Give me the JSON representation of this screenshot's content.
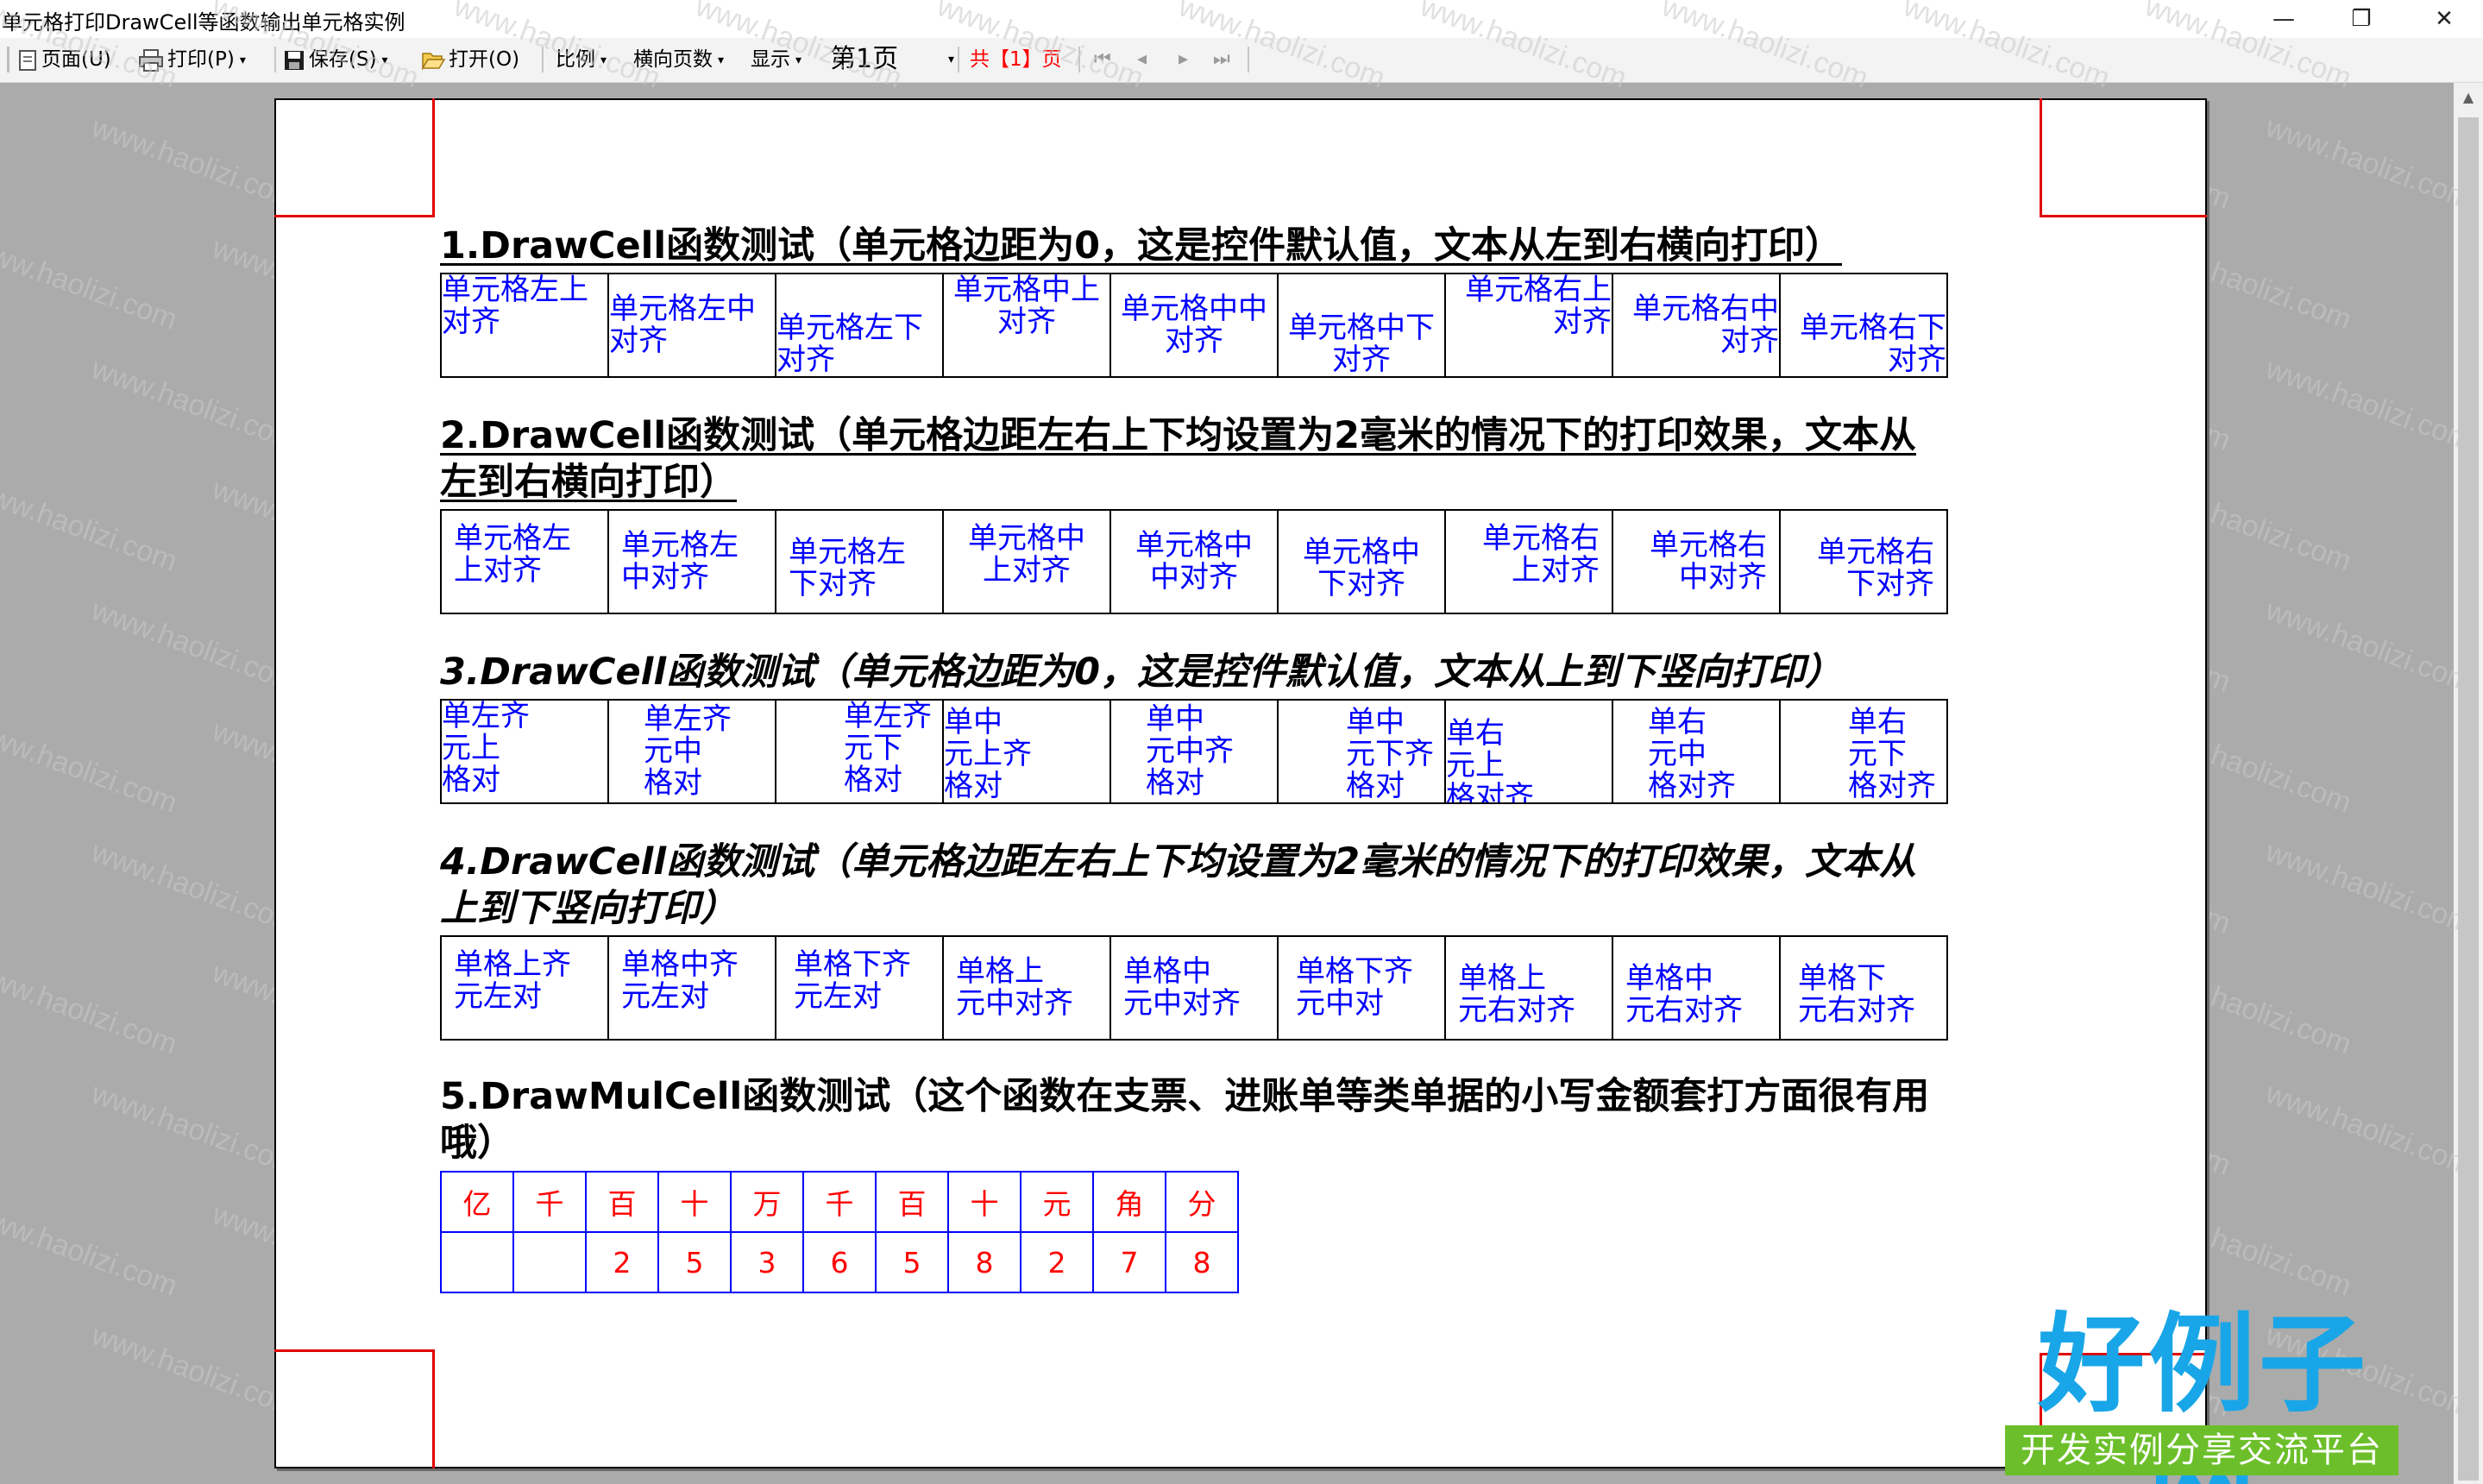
{
  "window": {
    "title": "单元格打印DrawCell等函数输出单元格实例",
    "minimize_glyph": "—",
    "restore_glyph": "❐",
    "close_glyph": "✕"
  },
  "toolbar": {
    "page": "页面(U)",
    "print": "打印(P)",
    "save": "保存(S)",
    "open": "打开(O)",
    "scale": "比例",
    "landscape_pages": "横向页数",
    "display": "显示",
    "current_page": "第1页",
    "total_pages": "共【1】页",
    "nav_first": "⏮",
    "nav_prev": "◂",
    "nav_next": "▸",
    "nav_last": "⏭"
  },
  "sections": [
    {
      "title": "1.DrawCell函数测试（单元格边距为0，这是控件默认值，文本从左到右横向打印）",
      "cells": [
        "单元格左上\n对齐",
        "单元格左中\n对齐",
        "单元格左下\n对齐",
        "单元格中上\n对齐",
        "单元格中中\n对齐",
        "单元格中下\n对齐",
        "单元格右上\n对齐",
        "单元格右中\n对齐",
        "单元格右下\n对齐"
      ]
    },
    {
      "title_line1": "2.DrawCell函数测试（单元格边距左右上下均设置为2毫米的情况下的打印效果，文本从",
      "title_line2": "左到右横向打印）",
      "cells": [
        "单元格左\n上对齐",
        "单元格左\n中对齐",
        "单元格左\n下对齐",
        "单元格中\n上对齐",
        "单元格中\n中对齐",
        "单元格中\n下对齐",
        "单元格右\n上对齐",
        "单元格右\n中对齐",
        "单元格右\n下对齐"
      ]
    },
    {
      "title": "3.DrawCell函数测试（单元格边距为0，这是控件默认值，文本从上到下竖向打印）",
      "cells": [
        "单左齐\n元上\n格对",
        "单左齐\n元中\n格对",
        "单左齐\n元下\n格对",
        "单中\n元上齐\n格对",
        "单中\n元中齐\n格对",
        "单中\n元下齐\n格对",
        "单右\n元上\n格对齐",
        "单右\n元中\n格对齐",
        "单右\n元下\n格对齐"
      ]
    },
    {
      "title_line1": "4.DrawCell函数测试（单元格边距左右上下均设置为2毫米的情况下的打印效果，文本从",
      "title_line2": "上到下竖向打印）",
      "cells": [
        "单格上齐\n元左对",
        "单格中齐\n元左对",
        "单格下齐\n元左对",
        "单格上\n元中对齐",
        "单格中\n元中对齐",
        "单格下齐\n元中对",
        "单格上\n元右对齐",
        "单格中\n元右对齐",
        "单格下\n元右对齐"
      ]
    },
    {
      "title_line1": "5.DrawMulCell函数测试（这个函数在支票、进账单等类单据的小写金额套打方面很有用",
      "title_line2": "哦）",
      "headers": [
        "亿",
        "千",
        "百",
        "十",
        "万",
        "千",
        "百",
        "十",
        "元",
        "角",
        "分"
      ],
      "values": [
        "",
        "",
        "2",
        "5",
        "3",
        "6",
        "5",
        "8",
        "2",
        "7",
        "8"
      ]
    }
  ],
  "watermark_text": "www.haolizi.com",
  "logo": {
    "main": "好例子网",
    "sub": "开发实例分享交流平台"
  },
  "colors": {
    "cell_text": "#0000ff",
    "money_text": "#ff0000",
    "money_border": "#0000ff",
    "corner_marks": "#e00000",
    "logo_blue": "#19a6e8",
    "logo_green": "#6cbf2a"
  }
}
